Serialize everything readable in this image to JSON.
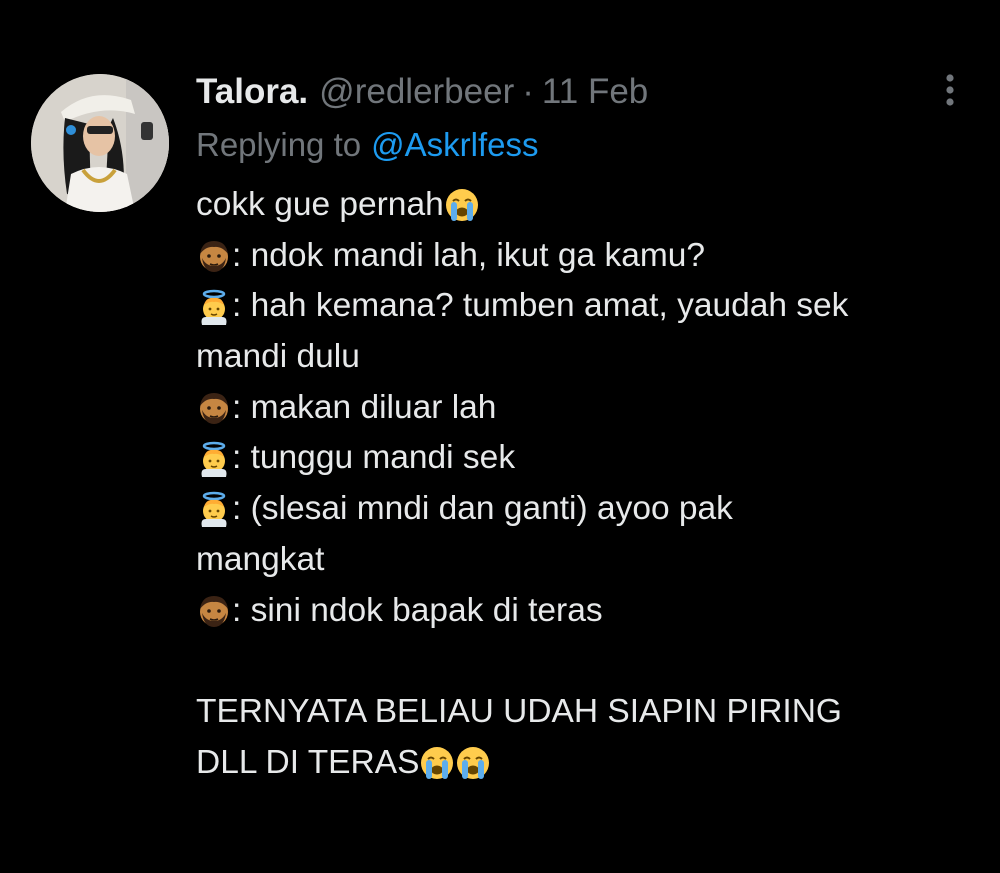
{
  "colors": {
    "background": "#000000",
    "text": "#e7e9ea",
    "muted": "#71767b",
    "link": "#1d9bf0"
  },
  "tweet": {
    "display_name": "Talora.",
    "handle": "@redlerbeer",
    "separator": "·",
    "time": "11 Feb",
    "replying_prefix": "Replying to",
    "replying_to": "@Askrlfess",
    "avatar_icon": "profile-photo",
    "more_icon": "more-vertical-icon",
    "lines": [
      {
        "emoji_before": null,
        "text": "cokk gue pernah",
        "emoji_after": [
          "crying-face-emoji"
        ]
      },
      {
        "emoji_before": "man-emoji",
        "text": ": ndok mandi lah, ikut ga kamu?",
        "emoji_after": []
      },
      {
        "emoji_before": "angel-emoji",
        "text": ": hah kemana? tumben amat, yaudah sek",
        "emoji_after": []
      },
      {
        "emoji_before": null,
        "text": "mandi dulu",
        "emoji_after": []
      },
      {
        "emoji_before": "man-emoji",
        "text": ": makan diluar lah",
        "emoji_after": []
      },
      {
        "emoji_before": "angel-emoji",
        "text": ": tunggu mandi sek",
        "emoji_after": []
      },
      {
        "emoji_before": "angel-emoji",
        "text": ": (slesai mndi dan ganti) ayoo pak",
        "emoji_after": []
      },
      {
        "emoji_before": null,
        "text": "mangkat",
        "emoji_after": []
      },
      {
        "emoji_before": "man-emoji",
        "text": ": sini ndok bapak di teras",
        "emoji_after": []
      },
      {
        "emoji_before": null,
        "text": "",
        "emoji_after": []
      },
      {
        "emoji_before": null,
        "text": "TERNYATA BELIAU UDAH SIAPIN PIRING",
        "emoji_after": []
      },
      {
        "emoji_before": null,
        "text": "DLL DI TERAS",
        "emoji_after": [
          "crying-face-emoji",
          "crying-face-emoji"
        ]
      }
    ]
  }
}
